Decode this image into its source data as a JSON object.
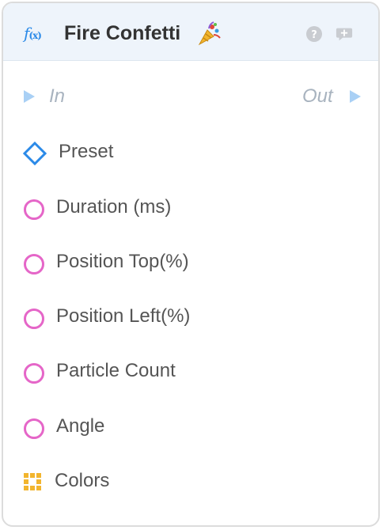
{
  "node": {
    "title": "Fire Confetti",
    "icons": {
      "type": "fx-icon",
      "title_emoji": "party-popper-icon",
      "help": "help-icon",
      "comment": "comment-icon"
    },
    "flow": {
      "in_label": "In",
      "out_label": "Out"
    },
    "inputs": [
      {
        "label": "Preset",
        "pin": "diamond"
      },
      {
        "label": "Duration (ms)",
        "pin": "circle"
      },
      {
        "label": "Position Top(%)",
        "pin": "circle"
      },
      {
        "label": "Position Left(%)",
        "pin": "circle"
      },
      {
        "label": "Particle Count",
        "pin": "circle"
      },
      {
        "label": "Angle",
        "pin": "circle"
      },
      {
        "label": "Colors",
        "pin": "grid"
      }
    ]
  },
  "colors": {
    "accent": "#2b8ae8",
    "header_bg": "#eef4fb",
    "pin_blue": "#2b8ae8",
    "pin_pink": "#e566c8",
    "pin_yellow": "#f2b52e",
    "flow_arrow": "#a9d0f5"
  }
}
